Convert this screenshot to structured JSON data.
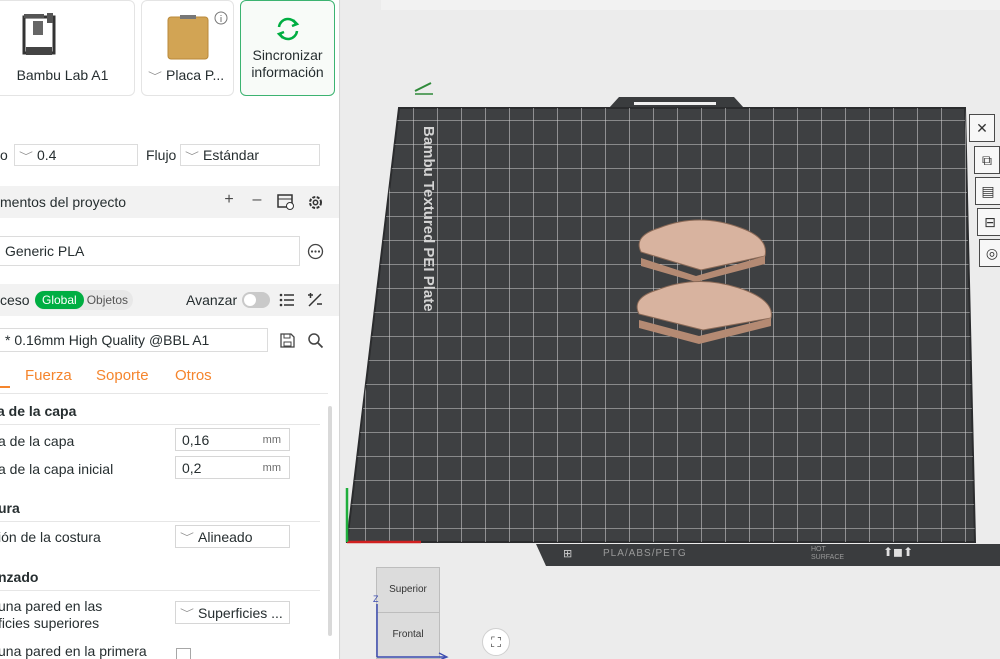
{
  "printer": {
    "name": "Bambu Lab A1"
  },
  "plate": {
    "name": "Placa P..."
  },
  "sync": {
    "line1": "Sincronizar",
    "line2": "información"
  },
  "nozzle": {
    "label": "o",
    "value": "0.4"
  },
  "flow": {
    "label": "Flujo",
    "value": "Estándar"
  },
  "filaments": {
    "title": "mentos del proyecto",
    "material": "Generic PLA"
  },
  "process": {
    "label": "ceso",
    "toggle_global": "Global",
    "toggle_objects": "Objetos",
    "advanced": "Avanzar",
    "preset": "* 0.16mm High Quality @BBL A1"
  },
  "tabs": [
    "Fuerza",
    "Soporte",
    "Otros"
  ],
  "layer_group": {
    "title": "a de la capa",
    "layer_height_label": "a de la capa",
    "layer_height_value": "0,16",
    "initial_layer_label": "a de la capa inicial",
    "initial_layer_value": "0,2",
    "unit": "mm"
  },
  "seam_group": {
    "title": "ura",
    "position_label": "ión de la costura",
    "position_value": "Alineado"
  },
  "advanced_group": {
    "title": "nzado",
    "wall_top_label_1": "una pared en las",
    "wall_top_label_2": "ficies superiores",
    "wall_top_value": "Superficies ...",
    "wall_first_label": "una pared en la primera"
  },
  "plate_view": {
    "bed_label": "Bambu Textured PEI Plate",
    "bottom_label": "PLA/ABS/PETG",
    "hot_label": "HOT SURFACE"
  },
  "view_cube": {
    "top": "Superior",
    "front": "Frontal",
    "axis_z": "Z"
  },
  "colors": {
    "accent": "#00ae42",
    "tab": "#f5852d",
    "bed": "#3e4042"
  },
  "icons": [
    "plus-icon",
    "minus-icon",
    "filament-manage-icon",
    "gear-icon",
    "dots-icon",
    "list-icon",
    "percent-icon",
    "save-icon",
    "search-icon",
    "close-icon"
  ]
}
